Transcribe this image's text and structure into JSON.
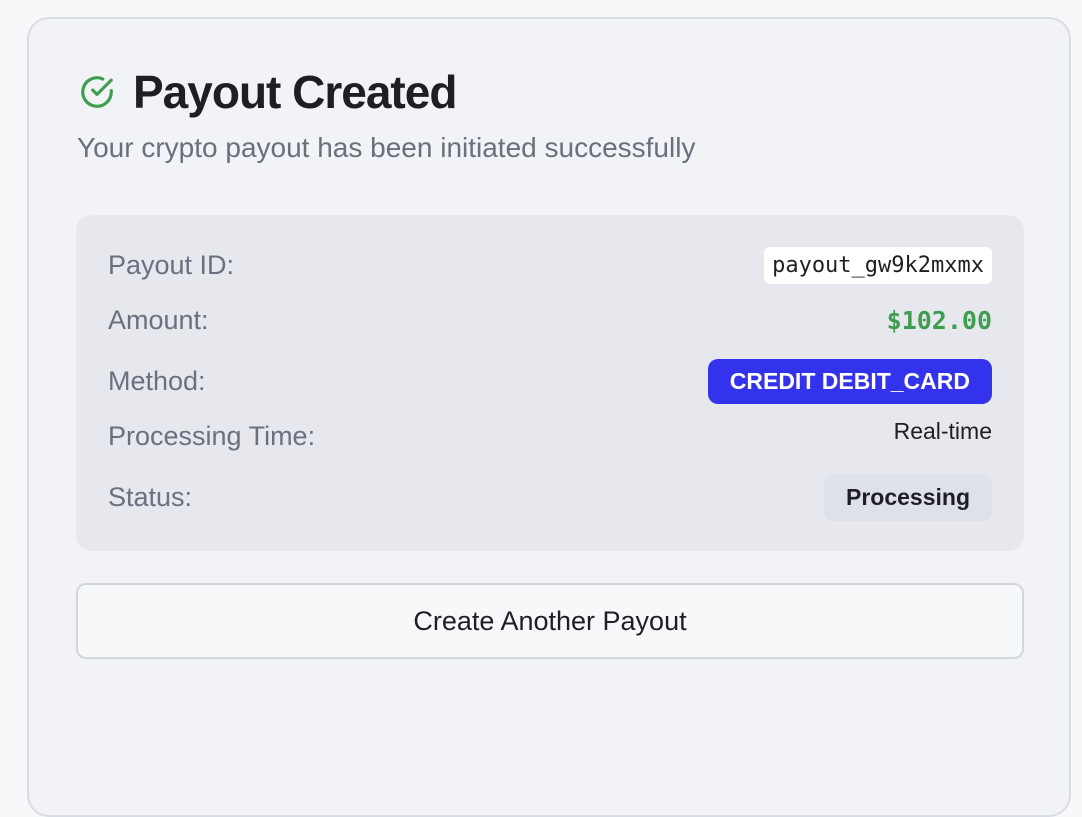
{
  "header": {
    "title": "Payout Created",
    "subtitle": "Your crypto payout has been initiated successfully",
    "icon": "check-circle-icon",
    "icon_color": "#3f9d4f"
  },
  "details": {
    "payout_id_label": "Payout ID:",
    "payout_id_value": "payout_gw9k2mxmx",
    "amount_label": "Amount:",
    "amount_value": "$102.00",
    "method_label": "Method:",
    "method_value": "CREDIT DEBIT_CARD",
    "processing_time_label": "Processing Time:",
    "processing_time_value": "Real-time",
    "status_label": "Status:",
    "status_value": "Processing"
  },
  "actions": {
    "create_another_label": "Create Another Payout"
  },
  "colors": {
    "accent": "#3333ee",
    "success": "#3f9d4f"
  }
}
